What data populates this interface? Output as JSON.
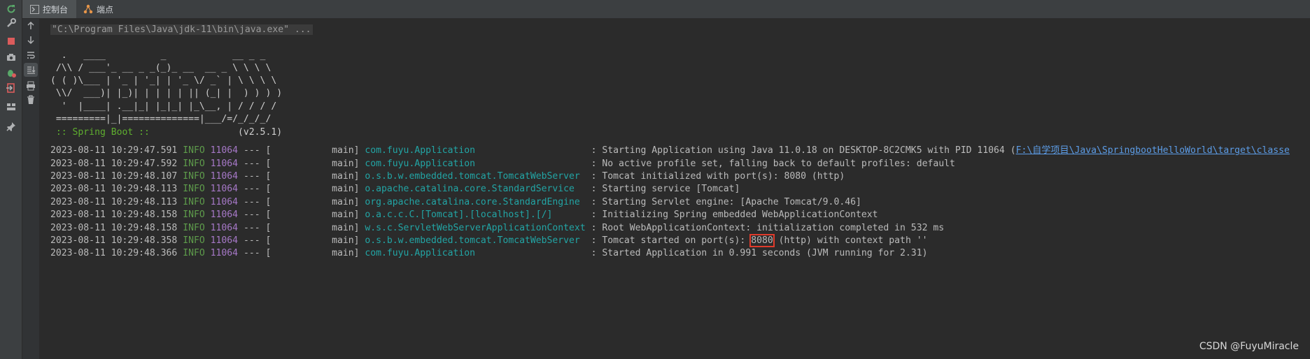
{
  "tabs": [
    {
      "label": "控制台",
      "icon": "console-icon"
    },
    {
      "label": "端点",
      "icon": "endpoints-icon"
    }
  ],
  "colors": {
    "info": "#5e9c4b",
    "pid": "#a678c7",
    "logger": "#22a5a5",
    "link": "#5c9ce6",
    "highlight": "#e03b2b"
  },
  "command": "\"C:\\Program Files\\Java\\jdk-11\\bin\\java.exe\" ...",
  "banner": [
    "  .   ____          _            __ _ _",
    " /\\\\ / ___'_ __ _ _(_)_ __  __ _ \\ \\ \\ \\",
    "( ( )\\___ | '_ | '_| | '_ \\/ _` | \\ \\ \\ \\",
    " \\\\/  ___)| |_)| | | | | || (_| |  ) ) ) )",
    "  '  |____| .__|_| |_|_| |_\\__, | / / / /",
    " =========|_|==============|___/=/_/_/_/"
  ],
  "boot": {
    "label": " :: Spring Boot :: ",
    "version": "               (v2.5.1)"
  },
  "logs": [
    {
      "ts": "2023-08-11 10:29:47.591",
      "level": "INFO",
      "pid": "11064",
      "sep": " --- [           main] ",
      "logger": "com.fuyu.Application                    ",
      "msg": " : Starting Application using Java 11.0.18 on DESKTOP-8C2CMK5 with PID 11064 (",
      "link": "F:\\自学项目\\Java\\SpringbootHelloWorld\\target\\classe"
    },
    {
      "ts": "2023-08-11 10:29:47.592",
      "level": "INFO",
      "pid": "11064",
      "sep": " --- [           main] ",
      "logger": "com.fuyu.Application                    ",
      "msg": " : No active profile set, falling back to default profiles: default"
    },
    {
      "ts": "2023-08-11 10:29:48.107",
      "level": "INFO",
      "pid": "11064",
      "sep": " --- [           main] ",
      "logger": "o.s.b.w.embedded.tomcat.TomcatWebServer ",
      "msg": " : Tomcat initialized with port(s): 8080 (http)"
    },
    {
      "ts": "2023-08-11 10:29:48.113",
      "level": "INFO",
      "pid": "11064",
      "sep": " --- [           main] ",
      "logger": "o.apache.catalina.core.StandardService  ",
      "msg": " : Starting service [Tomcat]"
    },
    {
      "ts": "2023-08-11 10:29:48.113",
      "level": "INFO",
      "pid": "11064",
      "sep": " --- [           main] ",
      "logger": "org.apache.catalina.core.StandardEngine ",
      "msg": " : Starting Servlet engine: [Apache Tomcat/9.0.46]"
    },
    {
      "ts": "2023-08-11 10:29:48.158",
      "level": "INFO",
      "pid": "11064",
      "sep": " --- [           main] ",
      "logger": "o.a.c.c.C.[Tomcat].[localhost].[/]      ",
      "msg": " : Initializing Spring embedded WebApplicationContext"
    },
    {
      "ts": "2023-08-11 10:29:48.158",
      "level": "INFO",
      "pid": "11064",
      "sep": " --- [           main] ",
      "logger": "w.s.c.ServletWebServerApplicationContext",
      "msg": " : Root WebApplicationContext: initialization completed in 532 ms"
    },
    {
      "ts": "2023-08-11 10:29:48.358",
      "level": "INFO",
      "pid": "11064",
      "sep": " --- [           main] ",
      "logger": "o.s.b.w.embedded.tomcat.TomcatWebServer ",
      "msg": " : Tomcat started on port(s): ",
      "highlight": "8080",
      "msg_after": " (http) with context path ''"
    },
    {
      "ts": "2023-08-11 10:29:48.366",
      "level": "INFO",
      "pid": "11064",
      "sep": " --- [           main] ",
      "logger": "com.fuyu.Application                    ",
      "msg": " : Started Application in 0.991 seconds (JVM running for 2.31)"
    }
  ],
  "watermark": "CSDN @FuyuMiracle"
}
